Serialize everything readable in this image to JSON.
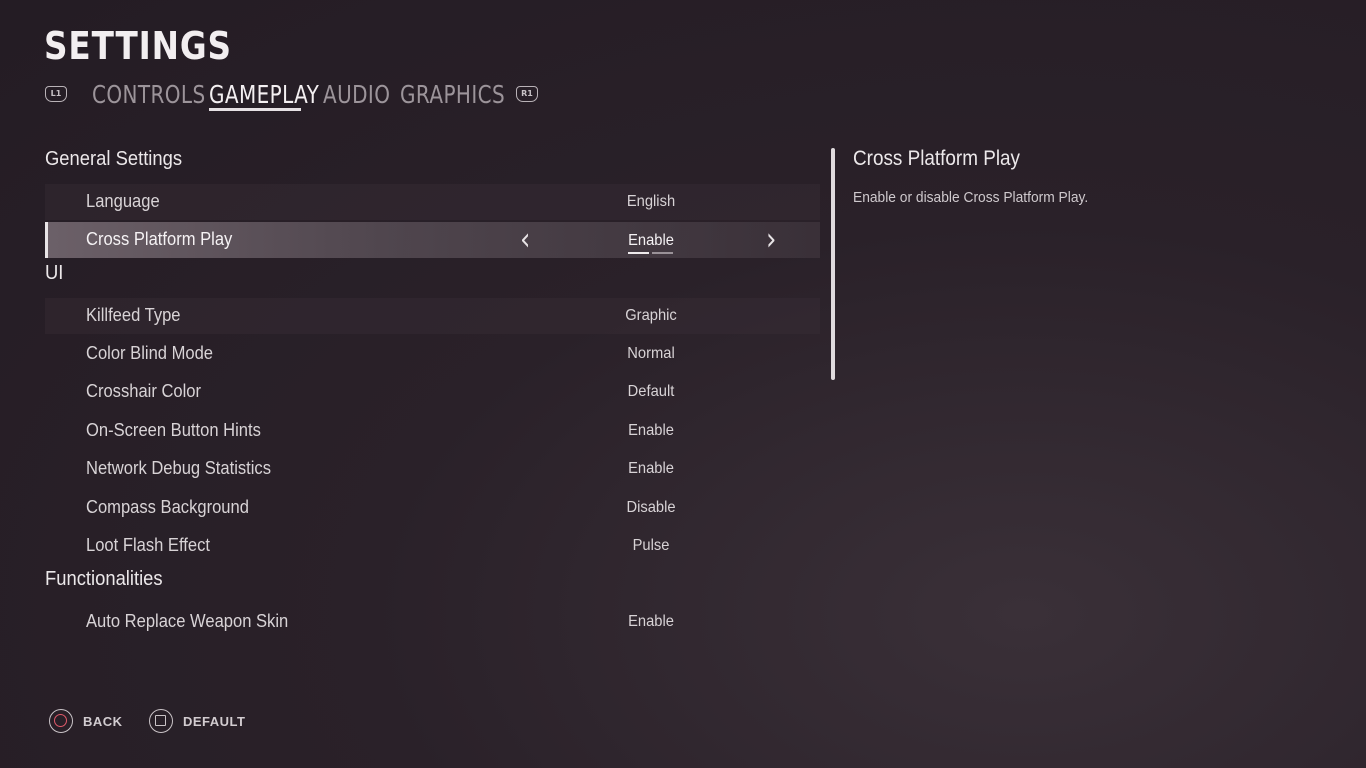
{
  "header": {
    "title": "SETTINGS"
  },
  "tabs": {
    "left_badge": "L1",
    "right_badge": "R1",
    "items": [
      {
        "label": "CONTROLS"
      },
      {
        "label": "GAMEPLAY",
        "active": true
      },
      {
        "label": "AUDIO"
      },
      {
        "label": "GRAPHICS"
      }
    ]
  },
  "sections": {
    "general": "General Settings",
    "ui": "UI",
    "functionalities": "Functionalities"
  },
  "settings": {
    "language": {
      "label": "Language",
      "value": "English"
    },
    "cross_platform": {
      "label": "Cross Platform Play",
      "value": "Enable",
      "selected": true
    },
    "killfeed": {
      "label": "Killfeed Type",
      "value": "Graphic"
    },
    "color_blind": {
      "label": "Color Blind Mode",
      "value": "Normal"
    },
    "crosshair": {
      "label": "Crosshair Color",
      "value": "Default"
    },
    "button_hints": {
      "label": "On-Screen Button Hints",
      "value": "Enable"
    },
    "network_debug": {
      "label": "Network Debug Statistics",
      "value": "Enable"
    },
    "compass_bg": {
      "label": "Compass Background",
      "value": "Disable"
    },
    "loot_flash": {
      "label": "Loot Flash Effect",
      "value": "Pulse"
    },
    "auto_replace": {
      "label": "Auto Replace Weapon Skin",
      "value": "Enable"
    }
  },
  "detail": {
    "title": "Cross Platform Play",
    "description": "Enable or disable Cross Platform Play."
  },
  "footer": {
    "back_label": "BACK",
    "default_label": "DEFAULT"
  },
  "icons": {
    "prev": "chevron-left-icon",
    "next": "chevron-right-icon",
    "back": "circle-button-icon",
    "default": "square-button-icon"
  },
  "colors": {
    "background": "#2a2129",
    "circle_button": "#e05a6a",
    "selection": "#786c74"
  }
}
